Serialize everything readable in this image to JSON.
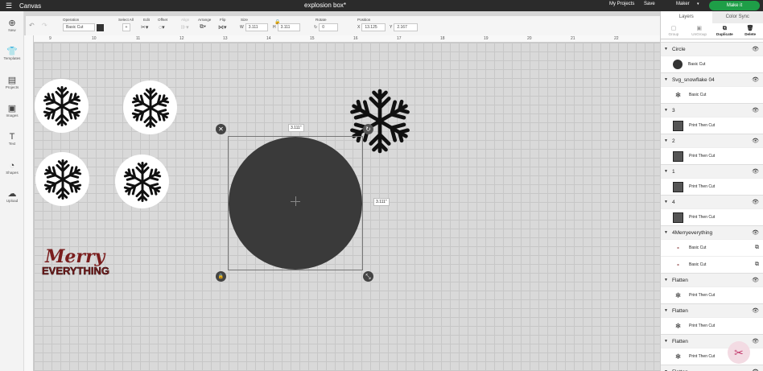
{
  "topbar": {
    "menu_icon": "hamburger-icon",
    "app_title": "Canvas",
    "document_title": "explosion box*",
    "my_projects": "My Projects",
    "save": "Save",
    "machine": "Maker",
    "make_it": "Make it"
  },
  "toolbar": {
    "operation_label": "Operation",
    "operation_value": "Basic Cut",
    "select_all_label": "Select All",
    "edit_label": "Edit",
    "offset_label": "Offset",
    "align_label": "Align",
    "arrange_label": "Arrange",
    "flip_label": "Flip",
    "size_label": "Size",
    "width_prefix": "W",
    "width_value": "3.111",
    "height_prefix": "H",
    "height_value": "3.111",
    "rotate_label": "Rotate",
    "rotate_value": "0",
    "position_label": "Position",
    "x_prefix": "X",
    "x_value": "13.125",
    "y_prefix": "Y",
    "y_value": "2.167"
  },
  "sidebar": [
    {
      "label": "New",
      "icon": "plus-circle-icon"
    },
    {
      "label": "Templates",
      "icon": "shirt-icon"
    },
    {
      "label": "Projects",
      "icon": "book-icon"
    },
    {
      "label": "Images",
      "icon": "image-icon"
    },
    {
      "label": "Text",
      "icon": "text-icon"
    },
    {
      "label": "Shapes",
      "icon": "shapes-icon"
    },
    {
      "label": "Upload",
      "icon": "cloud-upload-icon"
    }
  ],
  "ruler": [
    "9",
    "10",
    "11",
    "12",
    "13",
    "14",
    "15",
    "16",
    "17",
    "18",
    "19",
    "20",
    "21",
    "22"
  ],
  "canvas": {
    "width_label": "3.111\"",
    "height_label": "3.111\"",
    "merry_line1": "Merry",
    "merry_line2": "EVERYTHING"
  },
  "panel": {
    "tab_layers": "Layers",
    "tab_color_sync": "Color Sync",
    "actions": [
      "Group",
      "UnGroup",
      "Duplicate",
      "Delete"
    ],
    "groups": [
      {
        "name": "Circle",
        "rows": [
          {
            "label": "Basic Cut",
            "thumb": "dot"
          }
        ]
      },
      {
        "name": "Svg_snowflake 04",
        "rows": [
          {
            "label": "Basic Cut",
            "thumb": "snow"
          }
        ]
      },
      {
        "name": "3",
        "rows": [
          {
            "label": "Print Then Cut",
            "thumb": "pic"
          }
        ]
      },
      {
        "name": "2",
        "rows": [
          {
            "label": "Print Then Cut",
            "thumb": "pic"
          }
        ]
      },
      {
        "name": "1",
        "rows": [
          {
            "label": "Print Then Cut",
            "thumb": "pic"
          }
        ]
      },
      {
        "name": "4",
        "rows": [
          {
            "label": "Print Then Cut",
            "thumb": "pic"
          }
        ]
      },
      {
        "name": "4Merryeverything",
        "rows": [
          {
            "label": "Basic Cut",
            "thumb": "txt"
          },
          {
            "label": "Basic Cut",
            "thumb": "txt"
          }
        ]
      },
      {
        "name": "Flatten",
        "rows": [
          {
            "label": "Print Then Cut",
            "thumb": "snow"
          }
        ]
      },
      {
        "name": "Flatten",
        "rows": [
          {
            "label": "Print Then Cut",
            "thumb": "snow"
          }
        ]
      },
      {
        "name": "Flatten",
        "rows": [
          {
            "label": "Print Then Cut",
            "thumb": "snow"
          }
        ]
      },
      {
        "name": "Flatten",
        "rows": []
      }
    ]
  }
}
